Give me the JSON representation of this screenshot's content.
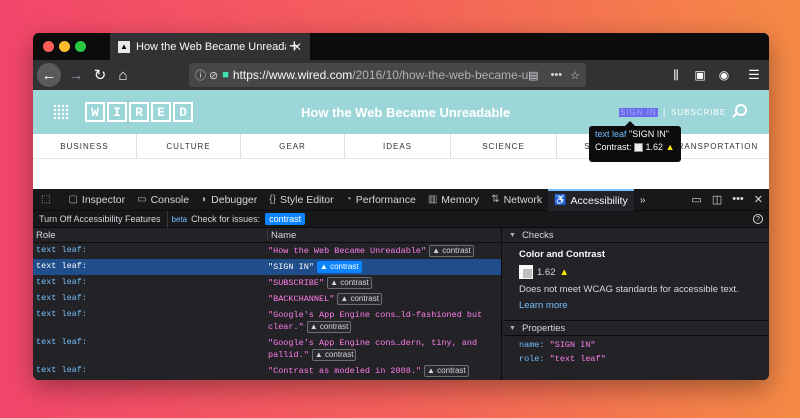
{
  "browser": {
    "tab_title": "How the Web Became Unreadab",
    "url_domain": "https://www.wired.com",
    "url_path": "/2016/10/how-the-web-became-u"
  },
  "page": {
    "logo_letters": [
      "W",
      "I",
      "R",
      "E",
      "D"
    ],
    "article_title": "How the Web Became Unreadable",
    "signin": "SIGN IN",
    "separator": "|",
    "subscribe": "SUBSCRIBE",
    "sections": [
      "BUSINESS",
      "CULTURE",
      "GEAR",
      "IDEAS",
      "SCIENCE",
      "SECURITY",
      "TRANSPORTATION"
    ],
    "tooltip": {
      "role": "text leaf",
      "name": "\"SIGN IN\"",
      "contrast_label": "Contrast:",
      "contrast_value": "1.62"
    }
  },
  "devtools": {
    "tabs": [
      "Inspector",
      "Console",
      "Debugger",
      "Style Editor",
      "Performance",
      "Memory",
      "Network",
      "Accessibility"
    ],
    "active_tab": "Accessibility",
    "turn_off": "Turn Off Accessibility Features",
    "beta": "beta",
    "check_label": "Check for issues:",
    "check_value": "contrast",
    "col_role": "Role",
    "col_name": "Name",
    "rows": [
      {
        "role": "text leaf:",
        "name": "\"How the Web Became Unreadable\"",
        "badge": "contrast"
      },
      {
        "role": "text leaf:",
        "name": "\"SIGN IN\"",
        "badge": "contrast",
        "selected": true
      },
      {
        "role": "text leaf:",
        "name": "\"SUBSCRIBE\"",
        "badge": "contrast"
      },
      {
        "role": "text leaf:",
        "name": "\"BACKCHANNEL\"",
        "badge": "contrast"
      },
      {
        "role": "text leaf:",
        "name": "\"Google's App Engine cons…ld-fashioned but clear.\"",
        "badge": "contrast"
      },
      {
        "role": "text leaf:",
        "name": "\"Google's App Engine cons…dern, tiny, and pallid.\"",
        "badge": "contrast"
      },
      {
        "role": "text leaf:",
        "name": "\"Contrast as modeled in 2008.\"",
        "badge": "contrast"
      }
    ],
    "checks": {
      "header": "Checks",
      "title": "Color and Contrast",
      "value": "1.62",
      "message": "Does not meet WCAG standards for accessible text.",
      "learn_more": "Learn more"
    },
    "properties": {
      "header": "Properties",
      "name_key": "name:",
      "name_val": "\"SIGN IN\"",
      "role_key": "role:",
      "role_val": "\"text leaf\""
    }
  }
}
